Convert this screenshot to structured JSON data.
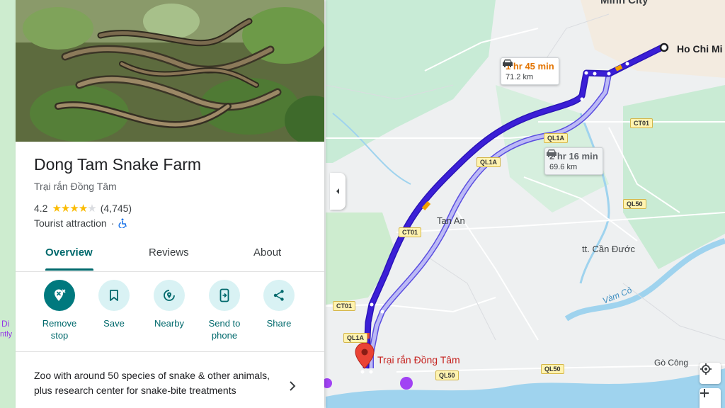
{
  "place": {
    "title": "Dong Tam Snake Farm",
    "subtitle": "Trại rắn Đồng Tâm",
    "rating": "4.2",
    "stars_filled": 4,
    "stars_total": 5,
    "review_count": "(4,745)",
    "category": "Tourist attraction",
    "category_separator": "·",
    "accessibility_icon": "wheelchair-icon",
    "description": "Zoo with around 50 species of snake & other animals, plus research center for snake-bite treatments"
  },
  "tabs": [
    {
      "label": "Overview",
      "active": true
    },
    {
      "label": "Reviews",
      "active": false
    },
    {
      "label": "About",
      "active": false
    }
  ],
  "actions": [
    {
      "label_line1": "Remove",
      "label_line2": "stop",
      "icon": "remove-stop-icon"
    },
    {
      "label_line1": "Save",
      "label_line2": "",
      "icon": "bookmark-icon"
    },
    {
      "label_line1": "Nearby",
      "label_line2": "",
      "icon": "nearby-icon"
    },
    {
      "label_line1": "Send to",
      "label_line2": "phone",
      "icon": "send-to-phone-icon"
    },
    {
      "label_line1": "Share",
      "label_line2": "",
      "icon": "share-icon"
    }
  ],
  "map": {
    "routes": [
      {
        "time": "1 hr 45 min",
        "distance": "71.2 km",
        "selected": true
      },
      {
        "time": "2 hr 16 min",
        "distance": "69.6 km",
        "selected": false
      }
    ],
    "destination_label": "Trại rắn Đồng Tâm",
    "origin_label": "Ho Chi Mi",
    "place_labels": {
      "tan_an": "Tan An",
      "can_duoc": "tt. Cần Đước",
      "go_cong": "Gò Công",
      "vam_co": "Vàm Cỏ",
      "city_top": "Minh City",
      "left_edge_1": "Di",
      "left_edge_2": "ntly"
    },
    "road_labels": {
      "ct01_a": "CT01",
      "ct01_b": "CT01",
      "ct01_c": "CT01",
      "ql1a_a": "QL1A",
      "ql1a_b": "QL1A",
      "ql1a_c": "QL1A",
      "ql50_a": "QL50",
      "ql50_b": "QL50",
      "ql50_c": "QL50"
    },
    "colors": {
      "route_selected": "#3b1fd6",
      "route_alternate": "#a9a7f0",
      "accent": "#00797e",
      "pin": "#ea4335"
    }
  }
}
